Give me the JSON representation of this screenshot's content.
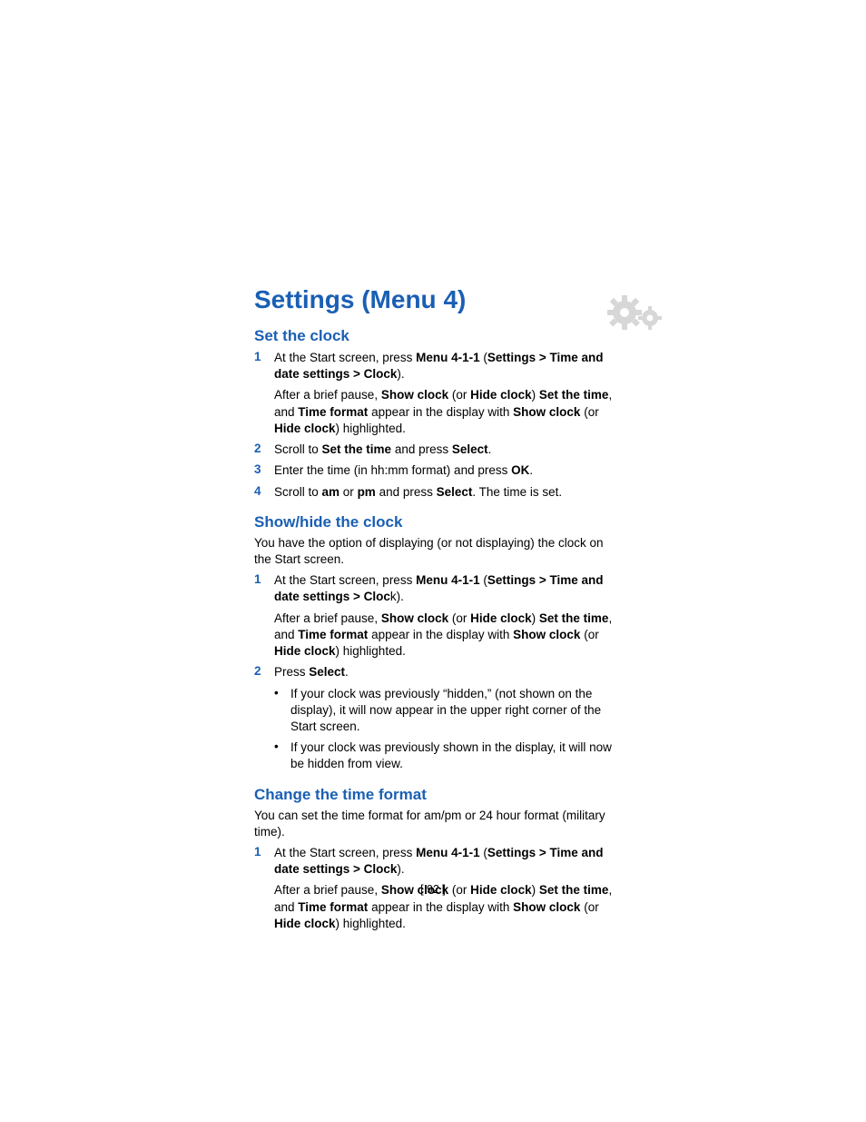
{
  "chapter": {
    "title": "Settings (Menu 4)"
  },
  "icon": {
    "name": "settings-gears-icon"
  },
  "s1": {
    "title": "Set the clock",
    "step1": {
      "num": "1",
      "a": "At the Start screen, press ",
      "b": "Menu 4-1-1",
      "c": " (",
      "d": "Settings > Time and date settings > Clock",
      "e": ")."
    },
    "note1": {
      "a": "After a brief pause, ",
      "b": "Show clock",
      "c": " (or ",
      "d": "Hide clock",
      "e": ") ",
      "f": "Set the time",
      "g": ", and ",
      "h": "Time format",
      "i": " appear in the display with ",
      "j": "Show clock",
      "k": " (or ",
      "l": "Hide clock",
      "m": ") highlighted."
    },
    "step2": {
      "num": "2",
      "a": "Scroll to ",
      "b": "Set the time",
      "c": " and press ",
      "d": "Select",
      "e": "."
    },
    "step3": {
      "num": "3",
      "a": "Enter the time (in hh:mm format) and press ",
      "b": "OK",
      "c": "."
    },
    "step4": {
      "num": "4",
      "a": "Scroll to ",
      "b": "am",
      "c": " or ",
      "d": "pm",
      "e": " and press ",
      "f": "Select",
      "g": ". The time is set."
    }
  },
  "s2": {
    "title": "Show/hide the clock",
    "intro": "You have the option of displaying (or not displaying) the clock on the Start screen.",
    "step1": {
      "num": "1",
      "a": "At the Start screen, press ",
      "b": "Menu 4-1-1",
      "c": " (",
      "d": "Settings > Time and date settings > Cloc",
      "e": "k)."
    },
    "note1": {
      "a": "After a brief pause, ",
      "b": "Show clock",
      "c": " (or ",
      "d": "Hide clock",
      "e": ") ",
      "f": "Set the time",
      "g": ", and ",
      "h": "Time format",
      "i": " appear in the display with ",
      "j": "Show clock",
      "k": " (or ",
      "l": "Hide clock",
      "m": ") highlighted."
    },
    "step2": {
      "num": "2",
      "a": "Press ",
      "b": "Select",
      "c": "."
    },
    "b1": "If your clock was previously “hidden,” (not shown on the display), it will now appear in the upper right corner of the Start screen.",
    "b2": "If your clock was previously shown in the display, it will now be hidden from view."
  },
  "s3": {
    "title": "Change the time format",
    "intro": "You can set the time format for am/pm or 24 hour format (military time).",
    "step1": {
      "num": "1",
      "a": "At the Start screen, press ",
      "b": "Menu 4-1-1",
      "c": " (",
      "d": "Settings > Time and date settings > Clock",
      "e": ")."
    },
    "note1": {
      "a": "After a brief pause, ",
      "b": "Show clock",
      "c": " (or ",
      "d": "Hide clock",
      "e": ") ",
      "f": "Set the time",
      "g": ", and ",
      "h": "Time format",
      "i": " appear in the display with ",
      "j": "Show clock",
      "k": " (or ",
      "l": "Hide clock",
      "m": ") highlighted."
    }
  },
  "page_number": "[ 92 ]"
}
